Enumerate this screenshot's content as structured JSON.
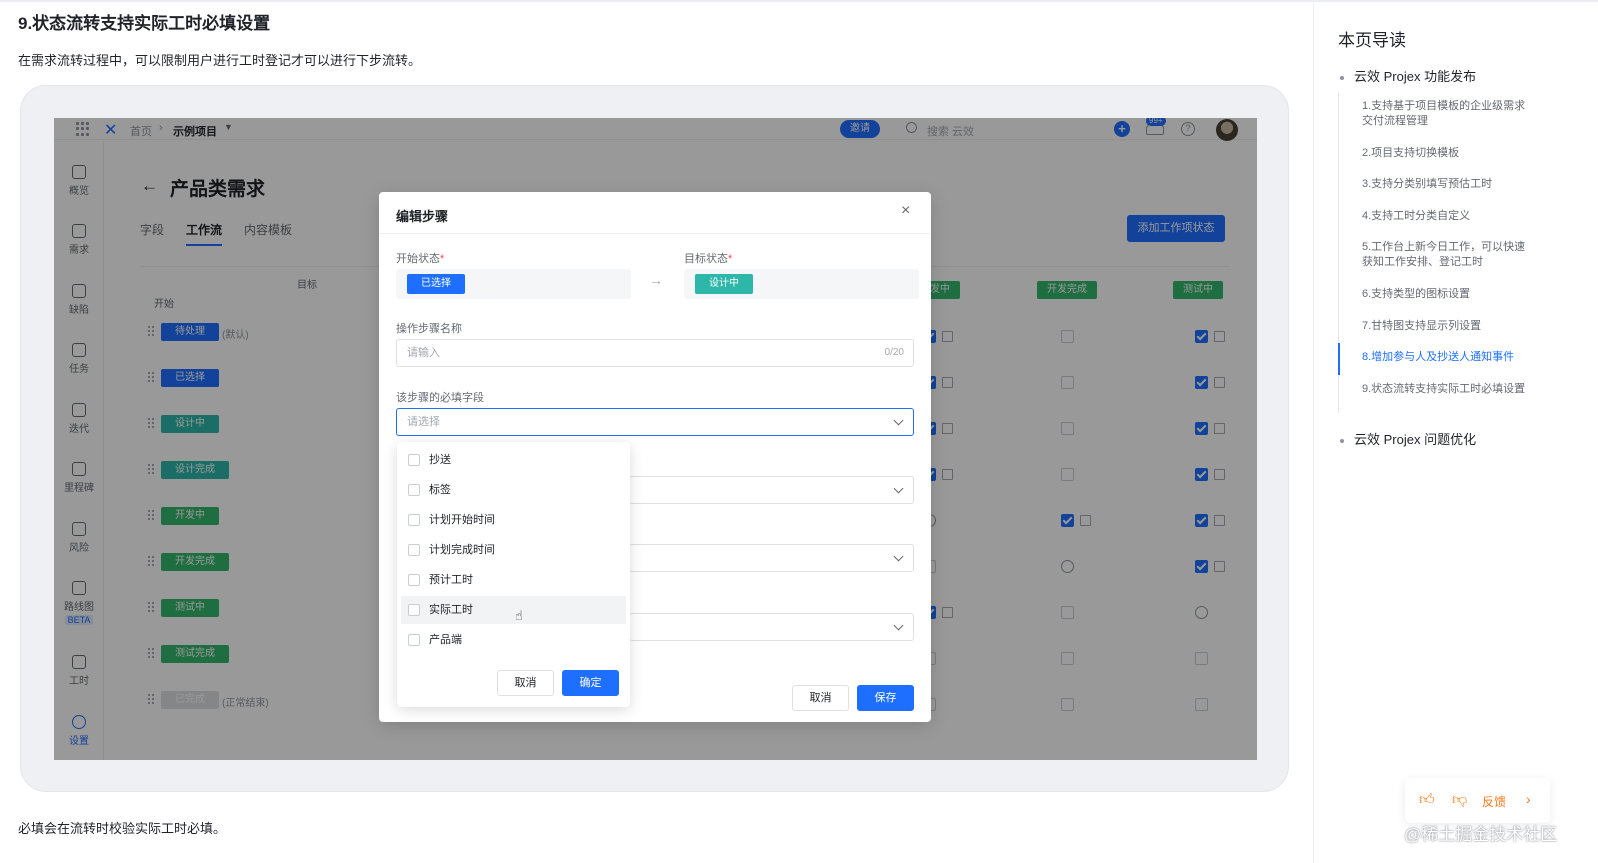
{
  "article": {
    "heading": "9.状态流转支持实际工时必填设置",
    "intro": "在需求流转过程中，可以限制用户进行工时登记才可以进行下步流转。",
    "outro": "必填会在流转时校验实际工时必填。"
  },
  "app": {
    "breadcrumb": {
      "home": "首页",
      "separator": "›",
      "project": "示例项目"
    },
    "invite_label": "邀请",
    "search_placeholder": "搜索 云效",
    "notification_badge": "99+",
    "help_label": "?",
    "sidebar": [
      {
        "label": "概览",
        "icon": "chart-icon"
      },
      {
        "label": "需求",
        "icon": "layers-icon"
      },
      {
        "label": "缺陷",
        "icon": "bug-icon"
      },
      {
        "label": "任务",
        "icon": "bulb-icon"
      },
      {
        "label": "迭代",
        "icon": "iteration-icon"
      },
      {
        "label": "里程碑",
        "icon": "pin-icon"
      },
      {
        "label": "风险",
        "icon": "warning-icon"
      },
      {
        "label": "路线图",
        "icon": "roadmap-icon",
        "badge": "BETA"
      },
      {
        "label": "工时",
        "icon": "timer-icon"
      },
      {
        "label": "设置",
        "icon": "settings-icon"
      }
    ],
    "page_title": "产品类需求",
    "back_arrow": "←",
    "tabs": [
      "字段",
      "工作流",
      "内容模板"
    ],
    "active_tab": "工作流",
    "add_state_button": "添加工作项状态",
    "table": {
      "target_label": "目标",
      "start_label": "开始",
      "col_heads": [
        "发中",
        "开发完成",
        "测试中"
      ],
      "rows": [
        {
          "state": "待处理",
          "note": "(默认)",
          "color": "#1e6fff"
        },
        {
          "state": "已选择",
          "note": "",
          "color": "#1e6fff"
        },
        {
          "state": "设计中",
          "note": "",
          "color": "#2db7a9"
        },
        {
          "state": "设计完成",
          "note": "",
          "color": "#2db7a9"
        },
        {
          "state": "开发中",
          "note": "",
          "color": "#34b76d"
        },
        {
          "state": "开发完成",
          "note": "",
          "color": "#34b76d"
        },
        {
          "state": "测试中",
          "note": "",
          "color": "#34b76d"
        },
        {
          "state": "测试完成",
          "note": "",
          "color": "#34b76d"
        },
        {
          "state": "已完成",
          "note": "(正常结束)",
          "color": "#dee0e3"
        }
      ]
    }
  },
  "modal": {
    "title": "编辑步骤",
    "close": "×",
    "start_state_label": "开始状态",
    "start_state_value": "已选择",
    "target_state_label": "目标状态",
    "target_state_value": "设计中",
    "arrow": "→",
    "required_mark": "*",
    "step_name_label": "操作步骤名称",
    "step_name_placeholder": "请输入",
    "step_name_counter": "0/20",
    "required_fields_label": "该步骤的必填字段",
    "required_fields_placeholder": "请选择",
    "options": [
      "抄送",
      "标签",
      "计划开始时间",
      "计划完成时间",
      "预计工时",
      "实际工时",
      "产品端"
    ],
    "hovered_option": "实际工时",
    "dropdown_cancel": "取消",
    "dropdown_confirm": "确定",
    "cancel": "取消",
    "save": "保存"
  },
  "toc": {
    "title": "本页导读",
    "sections": [
      {
        "label": "云效 Projex 功能发布"
      },
      {
        "label": "云效 Projex 问题优化"
      }
    ],
    "items": [
      "1.支持基于项目模板的企业级需求交付流程管理",
      "2.项目支持切换模板",
      "3.支持分类别填写预估工时",
      "4.支持工时分类自定义",
      "5.工作台上新今日工作，可以快速获知工作安排、登记工时",
      "6.支持类型的图标设置",
      "7.甘特图支持显示列设置",
      "8.增加参与人及抄送人通知事件",
      "9.状态流转支持实际工时必填设置"
    ],
    "active_item": "8.增加参与人及抄送人通知事件"
  },
  "feedback": {
    "like_icon": "thumb-up-icon",
    "dislike_icon": "thumb-down-icon",
    "label": "反馈",
    "chevron": "›"
  },
  "watermark": "@稀土掘金技术社区",
  "colors": {
    "accent": "#1e6fff",
    "teal": "#2db7a9",
    "green": "#34b76d",
    "orange": "#ff7a1a"
  }
}
